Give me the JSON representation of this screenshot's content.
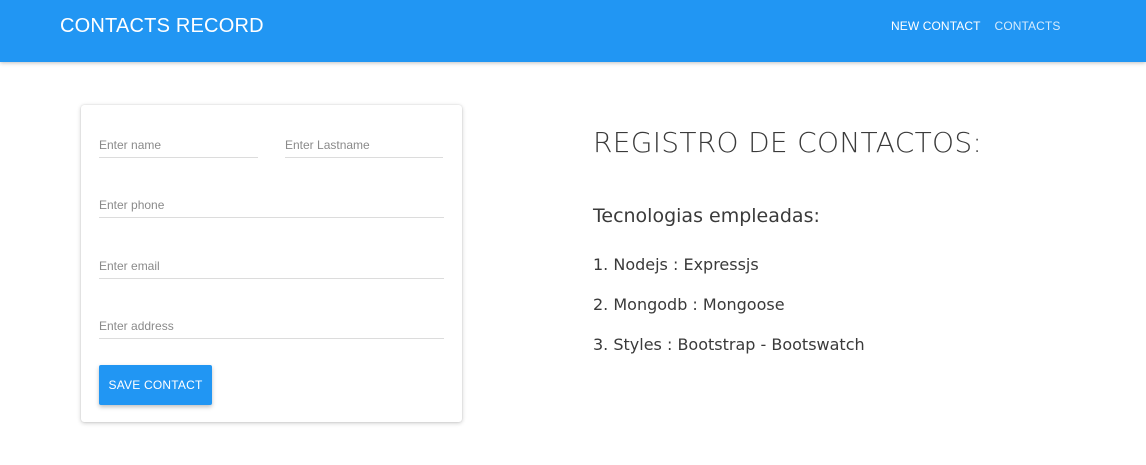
{
  "navbar": {
    "brand": "CONTACTS RECORD",
    "links": [
      {
        "label": "NEW CONTACT",
        "active": true
      },
      {
        "label": "CONTACTS",
        "active": false
      }
    ],
    "color": "#2196f3"
  },
  "form": {
    "name_placeholder": "Enter name",
    "lastname_placeholder": "Enter Lastname",
    "phone_placeholder": "Enter phone",
    "email_placeholder": "Enter email",
    "address_placeholder": "Enter address",
    "save_label": "SAVE CONTACT"
  },
  "info": {
    "title": "REGISTRO DE CONTACTOS:",
    "subtitle": "Tecnologias empleadas:",
    "items": [
      "1. Nodejs : Expressjs",
      "2. Mongodb : Mongoose",
      "3. Styles : Bootstrap - Bootswatch"
    ]
  }
}
